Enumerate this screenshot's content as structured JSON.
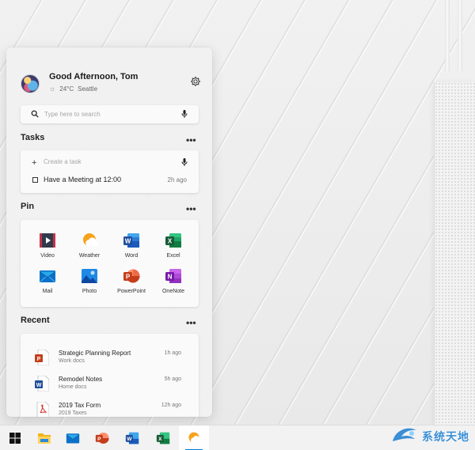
{
  "profile": {
    "greeting": "Good Afternoon, Tom",
    "temperature": "24°C",
    "city": "Seattle"
  },
  "search": {
    "placeholder": "Type here to search"
  },
  "tasks": {
    "title": "Tasks",
    "more": "•••",
    "add_symbol": "+",
    "create_placeholder": "Create a task",
    "items": [
      {
        "text": "Have a Meeting at 12:00",
        "time": "2h ago"
      }
    ]
  },
  "pin": {
    "title": "Pin",
    "more": "•••",
    "apps": [
      {
        "label": "Video",
        "icon": "video-icon"
      },
      {
        "label": "Weather",
        "icon": "weather-icon"
      },
      {
        "label": "Word",
        "icon": "word-icon"
      },
      {
        "label": "Excel",
        "icon": "excel-icon"
      },
      {
        "label": "Mail",
        "icon": "mail-icon"
      },
      {
        "label": "Photo",
        "icon": "photo-icon"
      },
      {
        "label": "PowerPoint",
        "icon": "powerpoint-icon"
      },
      {
        "label": "OneNote",
        "icon": "onenote-icon"
      }
    ]
  },
  "recent": {
    "title": "Recent",
    "more": "•••",
    "items": [
      {
        "name": "Strategic Planning Report",
        "sub": "Work docs",
        "time": "1h ago",
        "icon": "powerpoint-file-icon"
      },
      {
        "name": "Remodel Notes",
        "sub": "Home docs",
        "time": "5h ago",
        "icon": "word-file-icon"
      },
      {
        "name": "2019 Tax Form",
        "sub": "2019 Taxes",
        "time": "12h ago",
        "icon": "pdf-file-icon"
      }
    ]
  },
  "taskbar": {
    "items": [
      "windows-start-icon",
      "file-explorer-icon",
      "mail-icon",
      "powerpoint-icon",
      "word-icon",
      "excel-icon",
      "weather-icon"
    ]
  },
  "watermark": {
    "text": "系统天地"
  },
  "colors": {
    "word": "#2b579a",
    "excel": "#217346",
    "powerpoint": "#d24726",
    "onenote": "#7719aa",
    "mail": "#0a70c8",
    "weather": "#f7a21b",
    "accent": "#0078d4"
  }
}
